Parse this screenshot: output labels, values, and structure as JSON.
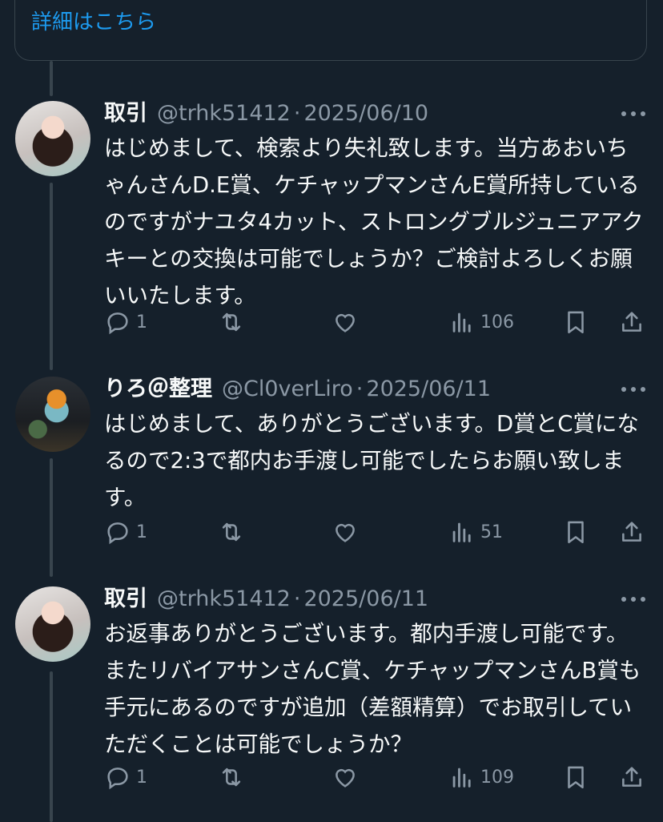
{
  "top_card": {
    "link_text": "詳細はこちら"
  },
  "tweets": [
    {
      "name": "取引",
      "handle": "@trhk51412",
      "separator": "·",
      "date": "2025/06/10",
      "text": "はじめまして、検索より失礼致します。当方あおいちゃんさんD.E賞、ケチャップマンさんE賞所持しているのですがナユタ4カット、ストロングブルジュニアアクキーとの交換は可能でしょうか？ご検討よろしくお願いいたします。",
      "reply_count": "1",
      "view_count": "106"
    },
    {
      "name": "りろ＠整理",
      "handle": "@Cl0verLiro",
      "separator": "·",
      "date": "2025/06/11",
      "text": "はじめまして、ありがとうございます。D賞とC賞になるので2:3で都内お手渡し可能でしたらお願い致します。",
      "reply_count": "1",
      "view_count": "51"
    },
    {
      "name": "取引",
      "handle": "@trhk51412",
      "separator": "·",
      "date": "2025/06/11",
      "text": "お返事ありがとうございます。都内手渡し可能です。またリバイアサンさんC賞、ケチャップマンさんB賞も手元にあるのですが追加（差額精算）でお取引していただくことは可能でしょうか？",
      "reply_count": "1",
      "view_count": "109"
    }
  ],
  "icons": {
    "reply": "reply-icon",
    "retweet": "retweet-icon",
    "like": "heart-icon",
    "views": "views-icon",
    "bookmark": "bookmark-icon",
    "share": "share-icon",
    "more": "more-icon"
  },
  "colors": {
    "background": "#15202b",
    "text": "#f7f9f9",
    "secondary": "#8b98a5",
    "link": "#1d9bf0",
    "border": "#38444d"
  }
}
